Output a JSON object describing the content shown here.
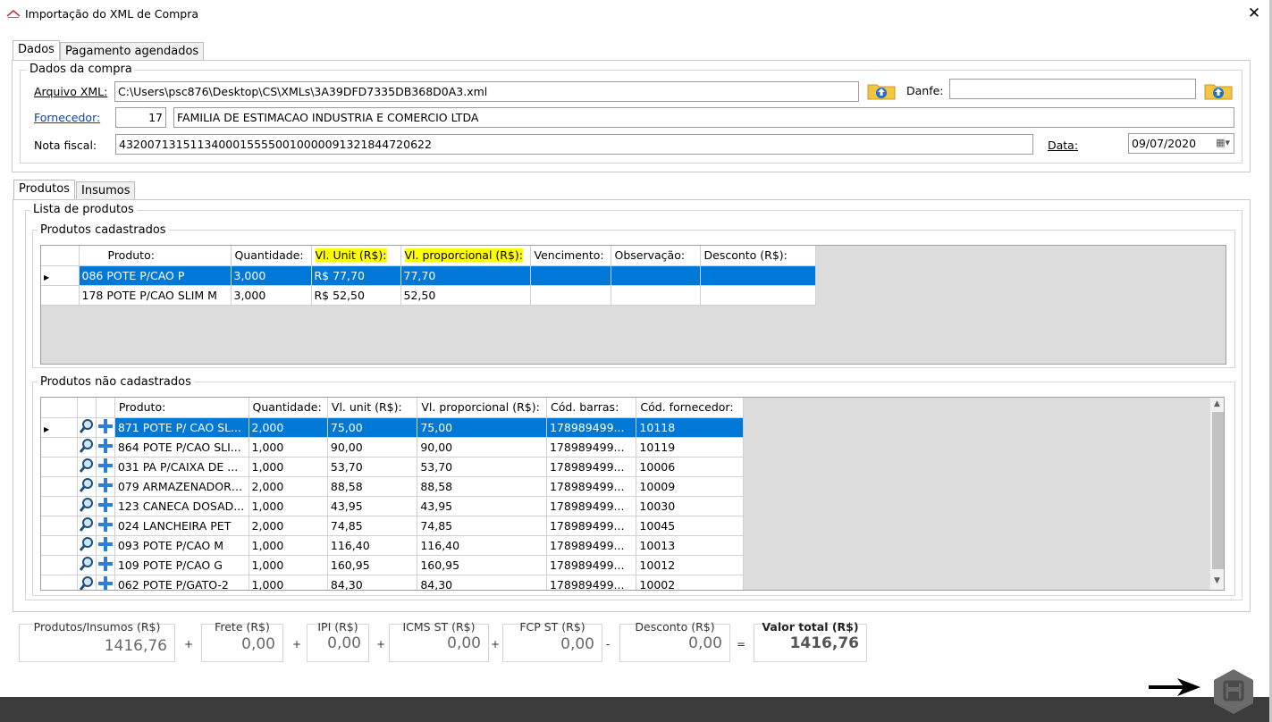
{
  "window": {
    "title": "Importação do XML de Compra",
    "close": "✕"
  },
  "tabs_top": [
    "Dados",
    "Pagamento agendados"
  ],
  "compra": {
    "group_label": "Dados da compra",
    "arquivo_label": "Arquivo XML:",
    "arquivo_value": "C:\\Users\\psc876\\Desktop\\CS\\XMLs\\3A39DFD7335DB368D0A3.xml",
    "danfe_label": "Danfe:",
    "danfe_value": "",
    "fornecedor_label": "Fornecedor:",
    "fornecedor_code": "17",
    "fornecedor_name": "FAMILIA DE ESTIMACAO INDUSTRIA E COMERCIO LTDA",
    "nota_label": "Nota fiscal:",
    "nota_value": "43200713151134000155550010000091321844720622",
    "data_label": "Data:",
    "data_value": "09/07/2020"
  },
  "tabs_mid": [
    "Produtos",
    "Insumos"
  ],
  "lista": {
    "group_label": "Lista de produtos"
  },
  "cadastrados": {
    "group_label": "Produtos cadastrados",
    "headers": [
      "Produto:",
      "Quantidade:",
      "Vl. Unit (R$):",
      "Vl. proporcional (R$):",
      "Vencimento:",
      "Observação:",
      "Desconto (R$):"
    ],
    "rows": [
      [
        "086 POTE P/CAO P",
        "3,000",
        "R$ 77,70",
        "77,70",
        "",
        "",
        ""
      ],
      [
        "178 POTE P/CAO SLIM M",
        "3,000",
        "R$ 52,50",
        "52,50",
        "",
        "",
        ""
      ]
    ]
  },
  "nao_cadastrados": {
    "group_label": "Produtos não cadastrados",
    "headers": [
      "Produto:",
      "Quantidade:",
      "Vl. unit (R$):",
      "Vl. proporcional (R$):",
      "Cód. barras:",
      "Cód. fornecedor:"
    ],
    "rows": [
      [
        "871 POTE P/ CAO SL...",
        "2,000",
        "75,00",
        "75,00",
        "178989499...",
        "10118"
      ],
      [
        "864 POTE P/CAO SLI...",
        "1,000",
        "90,00",
        "90,00",
        "178989499...",
        "10119"
      ],
      [
        "031 PA P/CAIXA DE ...",
        "1,000",
        "53,70",
        "53,70",
        "178989499...",
        "10006"
      ],
      [
        "079 ARMAZENADOR ...",
        "2,000",
        "88,58",
        "88,58",
        "178989499...",
        "10009"
      ],
      [
        "123 CANECA DOSAD...",
        "1,000",
        "43,95",
        "43,95",
        "178989499...",
        "10030"
      ],
      [
        "024 LANCHEIRA PET",
        "2,000",
        "74,85",
        "74,85",
        "178989499...",
        "10045"
      ],
      [
        "093 POTE P/CAO M",
        "1,000",
        "116,40",
        "116,40",
        "178989499...",
        "10013"
      ],
      [
        "109 POTE P/CAO G",
        "1,000",
        "160,95",
        "160,95",
        "178989499...",
        "10012"
      ],
      [
        "062 POTE P/GATO-2",
        "1,000",
        "84,30",
        "84,30",
        "178989499...",
        "10002"
      ]
    ]
  },
  "totais": {
    "produtos_label": "Produtos/Insumos (R$)",
    "produtos_value": "1416,76",
    "frete_label": "Frete (R$)",
    "frete_value": "0,00",
    "ipi_label": "IPI (R$)",
    "ipi_value": "0,00",
    "icms_label": "ICMS ST (R$)",
    "icms_value": "0,00",
    "fcp_label": "FCP ST (R$)",
    "fcp_value": "0,00",
    "desconto_label": "Desconto (R$)",
    "desconto_value": "0,00",
    "total_label": "Valor total (R$)",
    "total_value": "1416,76",
    "ops": [
      "+",
      "+",
      "+",
      "+",
      "-",
      "="
    ]
  },
  "icons": {
    "app": "app-logo",
    "folder": "folder-upload-icon",
    "calendar": "calendar-icon",
    "search": "magnifier-icon",
    "add": "plus-icon",
    "save": "save-icon",
    "arrow": "arrow-right-icon"
  }
}
